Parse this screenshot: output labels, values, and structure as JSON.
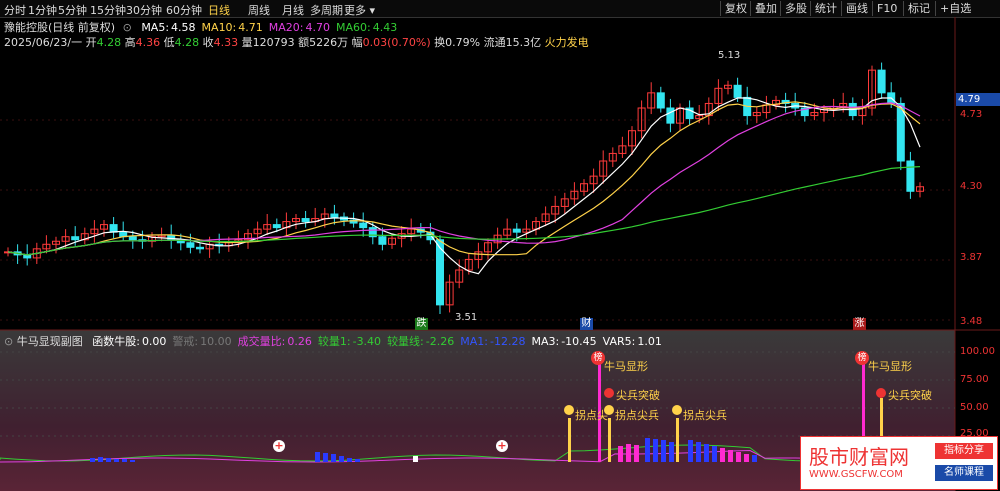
{
  "toolbar": {
    "periods": [
      "分时",
      "1分钟",
      "5分钟",
      "15分钟",
      "30分钟",
      "60分钟",
      "日线",
      "周线",
      "月线",
      "多周期",
      "更多"
    ],
    "right": [
      "复权",
      "叠加",
      "多股",
      "统计",
      "画线",
      "F10",
      "标记",
      "+自选"
    ]
  },
  "header": {
    "stock": "豫能控股(日线 前复权)",
    "ma": [
      {
        "label": "MA5:",
        "value": "4.58",
        "color": "#ffffff"
      },
      {
        "label": "MA10:",
        "value": "4.71",
        "color": "#ffd24a"
      },
      {
        "label": "MA20:",
        "value": "4.70",
        "color": "#e040e0"
      },
      {
        "label": "MA60:",
        "value": "4.43",
        "color": "#33cc33"
      }
    ],
    "date": "2025/06/23/一",
    "open_label": "开",
    "open": "4.28",
    "high_label": "高",
    "high": "4.36",
    "low_label": "低",
    "low": "4.28",
    "close_label": "收",
    "close": "4.33",
    "vol_label": "量",
    "vol": "120793",
    "amt_label": "额",
    "amt": "5226万",
    "chg_label": "幅",
    "chg": "0.03(0.70%)",
    "turn": "换0.79%",
    "float": "流通15.3亿",
    "concept": "火力发电"
  },
  "price_axis": {
    "current": "4.79",
    "ticks": [
      "4.73",
      "4.30",
      "3.87",
      "3.48"
    ]
  },
  "annotations": {
    "high": "5.13",
    "low": "3.51",
    "fall_tag": "跌",
    "fin_tag": "财",
    "rise_tag": "涨"
  },
  "sub": {
    "title": "牛马显现副图",
    "items": [
      {
        "label": "函数牛股:",
        "value": "0.00",
        "color": "#ffffff"
      },
      {
        "label": "警戒:",
        "value": "10.00",
        "color": "#777777"
      },
      {
        "label": "成交量比:",
        "value": "0.26",
        "color": "#e040e0"
      },
      {
        "label": "较量1:",
        "value": "-3.40",
        "color": "#33cc33"
      },
      {
        "label": "较量线:",
        "value": "-2.26",
        "color": "#33cc33"
      },
      {
        "label": "MA1:",
        "value": "-12.28",
        "color": "#3355ff"
      },
      {
        "label": "MA3:",
        "value": "-10.45",
        "color": "#ffffff"
      },
      {
        "label": "VAR5:",
        "value": "1.01",
        "color": "#ffffff"
      }
    ],
    "axis": [
      "100.00",
      "75.00",
      "50.00",
      "25.00"
    ],
    "signals": {
      "bang": "榜",
      "niuma": "牛马显形",
      "jianbing": "尖兵突破",
      "guaidian": "拐点尖兵",
      "guaidian_short": "拐点尖"
    }
  },
  "watermark": {
    "title": "股市财富网",
    "url": "WWW.GSCFW.COM",
    "tag1": "指标分享",
    "tag2": "名师课程"
  },
  "chart_data": {
    "type": "candlestick",
    "closes": [
      3.9,
      3.88,
      3.86,
      3.92,
      3.95,
      3.97,
      4.0,
      3.98,
      4.02,
      4.05,
      4.08,
      4.03,
      4.0,
      3.98,
      3.97,
      4.0,
      4.01,
      3.98,
      3.96,
      3.93,
      3.92,
      3.95,
      3.94,
      3.96,
      3.98,
      4.02,
      4.05,
      4.08,
      4.06,
      4.1,
      4.12,
      4.1,
      4.12,
      4.15,
      4.13,
      4.11,
      4.09,
      4.06,
      4.0,
      3.95,
      3.99,
      4.02,
      4.05,
      4.03,
      3.98,
      3.55,
      3.7,
      3.78,
      3.85,
      3.9,
      3.96,
      4.01,
      4.05,
      4.03,
      4.05,
      4.1,
      4.15,
      4.2,
      4.25,
      4.3,
      4.35,
      4.4,
      4.5,
      4.55,
      4.6,
      4.7,
      4.85,
      4.95,
      4.85,
      4.75,
      4.85,
      4.78,
      4.8,
      4.88,
      4.98,
      5.0,
      4.92,
      4.8,
      4.82,
      4.87,
      4.9,
      4.88,
      4.85,
      4.8,
      4.82,
      4.84,
      4.86,
      4.88,
      4.8,
      4.85,
      5.1,
      4.95,
      4.88,
      4.5,
      4.3,
      4.33
    ]
  }
}
